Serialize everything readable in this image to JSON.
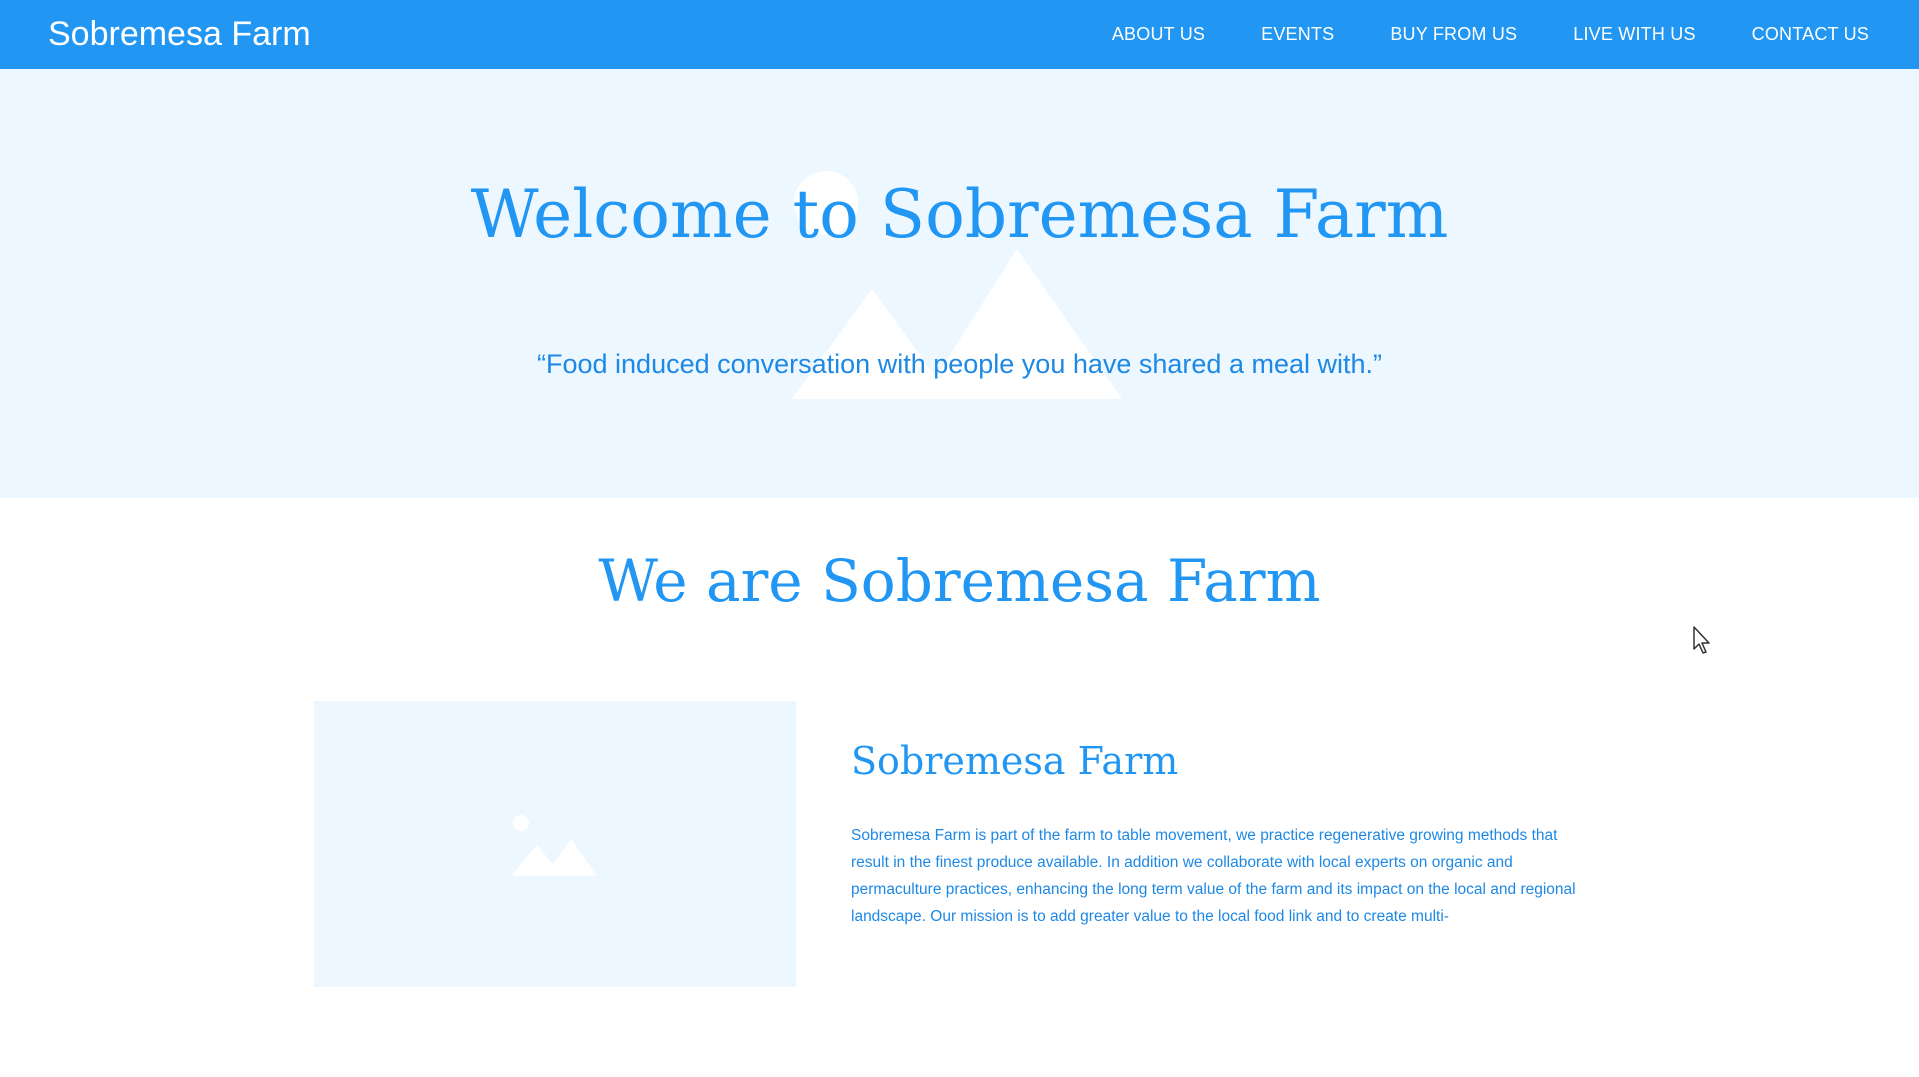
{
  "brand": "Sobremesa Farm",
  "nav": {
    "links": [
      "ABOUT US",
      "EVENTS",
      "BUY FROM US",
      "LIVE WITH US",
      "CONTACT US"
    ]
  },
  "hero": {
    "title": "Welcome to Sobremesa Farm",
    "quote": "“Food induced conversation with people you have shared a meal with.”",
    "background_icon": "image-placeholder-icon"
  },
  "about": {
    "title": "We are Sobremesa Farm",
    "image_icon": "image-placeholder-icon",
    "card_title": "Sobremesa Farm",
    "card_text": "Sobremesa Farm is part of the farm to table movement, we practice regenerative growing methods that result in the finest produce available. In addition we collaborate with local experts on organic and permaculture practices, enhancing the long term value of the farm and its impact on the local and regional landscape. Our mission is to add greater value to the local food link and to create multi-"
  },
  "colors": {
    "primary": "#2196F3",
    "hero_bg": "#EDF7FF",
    "text_blue": "#1E88E5"
  }
}
